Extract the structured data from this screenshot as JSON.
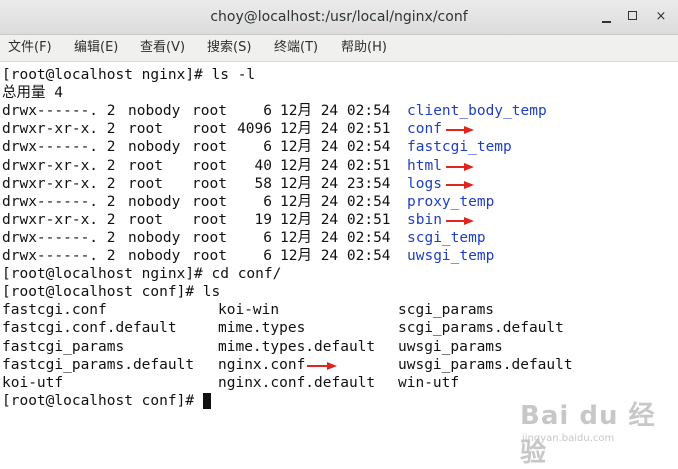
{
  "window": {
    "title": "choy@localhost:/usr/local/nginx/conf",
    "controls": {
      "minimize": "minimize",
      "maximize": "maximize",
      "close": "×"
    }
  },
  "menu": [
    "文件(F)",
    "编辑(E)",
    "查看(V)",
    "搜索(S)",
    "终端(T)",
    "帮助(H)"
  ],
  "terminal": {
    "cmd1": "[root@localhost nginx]# ls -l",
    "total": "总用量 4",
    "listing": [
      {
        "perm": "drwx------. 2",
        "owner": "nobody",
        "group": "root",
        "size": "6",
        "date": "12月 24 02:54",
        "name": "client_body_temp",
        "arrow": false
      },
      {
        "perm": "drwxr-xr-x. 2",
        "owner": "root",
        "group": "root",
        "size": "4096",
        "date": "12月 24 02:51",
        "name": "conf",
        "arrow": true
      },
      {
        "perm": "drwx------. 2",
        "owner": "nobody",
        "group": "root",
        "size": "6",
        "date": "12月 24 02:54",
        "name": "fastcgi_temp",
        "arrow": false
      },
      {
        "perm": "drwxr-xr-x. 2",
        "owner": "root",
        "group": "root",
        "size": "40",
        "date": "12月 24 02:51",
        "name": "html",
        "arrow": true
      },
      {
        "perm": "drwxr-xr-x. 2",
        "owner": "root",
        "group": "root",
        "size": "58",
        "date": "12月 24 23:54",
        "name": "logs",
        "arrow": true
      },
      {
        "perm": "drwx------. 2",
        "owner": "nobody",
        "group": "root",
        "size": "6",
        "date": "12月 24 02:54",
        "name": "proxy_temp",
        "arrow": false
      },
      {
        "perm": "drwxr-xr-x. 2",
        "owner": "root",
        "group": "root",
        "size": "19",
        "date": "12月 24 02:51",
        "name": "sbin",
        "arrow": true
      },
      {
        "perm": "drwx------. 2",
        "owner": "nobody",
        "group": "root",
        "size": "6",
        "date": "12月 24 02:54",
        "name": "scgi_temp",
        "arrow": false
      },
      {
        "perm": "drwx------. 2",
        "owner": "nobody",
        "group": "root",
        "size": "6",
        "date": "12月 24 02:54",
        "name": "uwsgi_temp",
        "arrow": false
      }
    ],
    "cmd2": "[root@localhost nginx]# cd conf/",
    "cmd3": "[root@localhost conf]# ls",
    "files": [
      [
        "fastcgi.conf",
        "koi-win",
        "scgi_params"
      ],
      [
        "fastcgi.conf.default",
        "mime.types",
        "scgi_params.default"
      ],
      [
        "fastcgi_params",
        "mime.types.default",
        "uwsgi_params"
      ],
      [
        "fastcgi_params.default",
        "nginx.conf",
        "uwsgi_params.default"
      ],
      [
        "koi-utf",
        "nginx.conf.default",
        "win-utf"
      ]
    ],
    "file_arrow": "nginx.conf",
    "prompt": "[root@localhost conf]# "
  },
  "watermark": {
    "main": "Bai du 经验",
    "sub": "jingyan.baidu.com"
  },
  "colors": {
    "directory": "#1f3fbf",
    "arrow": "#e0261c",
    "text": "#111111"
  }
}
